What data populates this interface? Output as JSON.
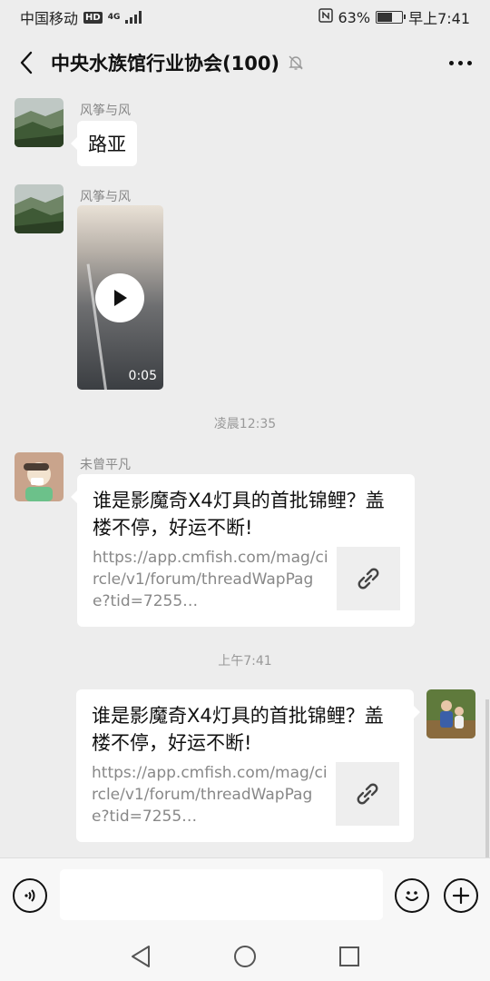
{
  "status_bar": {
    "carrier": "中国移动",
    "hd_badge": "HD",
    "network_type": "4G",
    "battery_percent_label": "63%",
    "battery_level": 0.63,
    "time": "早上7:41",
    "nfc_icon": "nfc-icon"
  },
  "header": {
    "title": "中央水族馆行业协会(100)",
    "back_icon": "chevron-left-icon",
    "mute_icon": "bell-off-icon",
    "more_icon": "more-dots-icon"
  },
  "messages": [
    {
      "type": "text",
      "side": "left",
      "sender": "风筝与风",
      "text": "路亚"
    },
    {
      "type": "video",
      "side": "left",
      "sender": "风筝与风",
      "duration": "0:05"
    },
    {
      "type": "timestamp",
      "text": "凌晨12:35"
    },
    {
      "type": "link",
      "side": "left",
      "sender": "未曾平凡",
      "title": "谁是影魔奇X4灯具的首批锦鲤？盖楼不停，好运不断!",
      "url": "https://app.cmfish.com/mag/circle/v1/forum/threadWapPage?tid=7255…"
    },
    {
      "type": "timestamp",
      "text": "上午7:41"
    },
    {
      "type": "link",
      "side": "right",
      "title": "谁是影魔奇X4灯具的首批锦鲤？盖楼不停，好运不断!",
      "url": "https://app.cmfish.com/mag/circle/v1/forum/threadWapPage?tid=7255…"
    }
  ],
  "input_bar": {
    "placeholder": "",
    "voice_icon": "voice-icon",
    "emoji_icon": "emoji-icon",
    "plus_icon": "plus-circle-icon"
  },
  "nav_bar": {
    "back_icon": "nav-back-icon",
    "home_icon": "nav-home-icon",
    "recents_icon": "nav-recents-icon"
  },
  "colors": {
    "chat_background": "#ededed",
    "bubble": "#ffffff",
    "muted_text": "#888888"
  }
}
